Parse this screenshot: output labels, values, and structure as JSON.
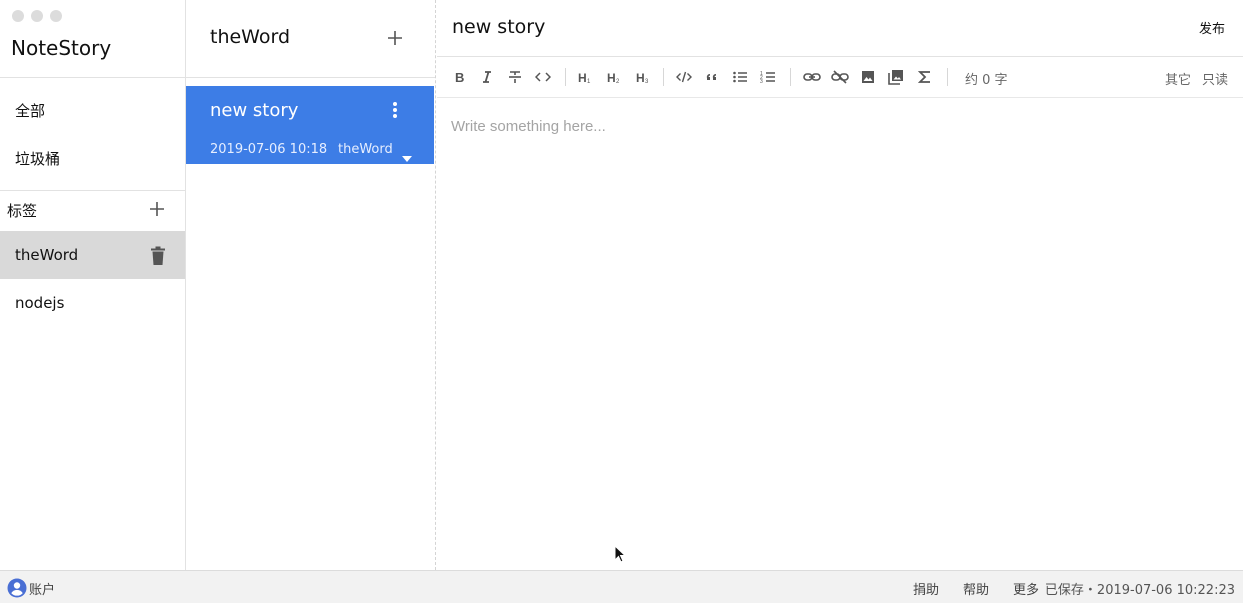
{
  "sidebar": {
    "app_title": "NoteStory",
    "items": [
      {
        "label": "全部"
      },
      {
        "label": "垃圾桶"
      }
    ],
    "tags_header": "标签",
    "tags": [
      {
        "label": "theWord",
        "active": true
      },
      {
        "label": "nodejs",
        "active": false
      }
    ]
  },
  "notelist": {
    "title": "theWord",
    "notes": [
      {
        "title": "new story",
        "date": "2019-07-06 10:18",
        "tag": "theWord"
      }
    ]
  },
  "editor": {
    "title": "new story",
    "publish_label": "发布",
    "placeholder": "Write something here...",
    "toolbar": {
      "word_count": "约 0 字",
      "other_label": "其它",
      "readonly_label": "只读"
    }
  },
  "statusbar": {
    "account_label": "账户",
    "donate_label": "捐助",
    "help_label": "帮助",
    "more_label": "更多",
    "save_status": "已保存・2019-07-06 10:22:23"
  },
  "colors": {
    "accent": "#3d7de6",
    "active_tag_bg": "#d9d9d9",
    "statusbar_bg": "#f2f2f2",
    "icon": "#555555"
  },
  "icons": [
    "plus-icon",
    "trash-icon",
    "more-vertical-icon",
    "caret-down-icon",
    "bold-icon",
    "italic-icon",
    "strikethrough-icon",
    "inline-code-icon",
    "heading1-icon",
    "heading2-icon",
    "heading3-icon",
    "code-block-icon",
    "quote-icon",
    "bullet-list-icon",
    "ordered-list-icon",
    "link-icon",
    "unlink-icon",
    "image-icon",
    "gallery-icon",
    "sigma-icon",
    "account-icon",
    "mouse-cursor-icon"
  ]
}
